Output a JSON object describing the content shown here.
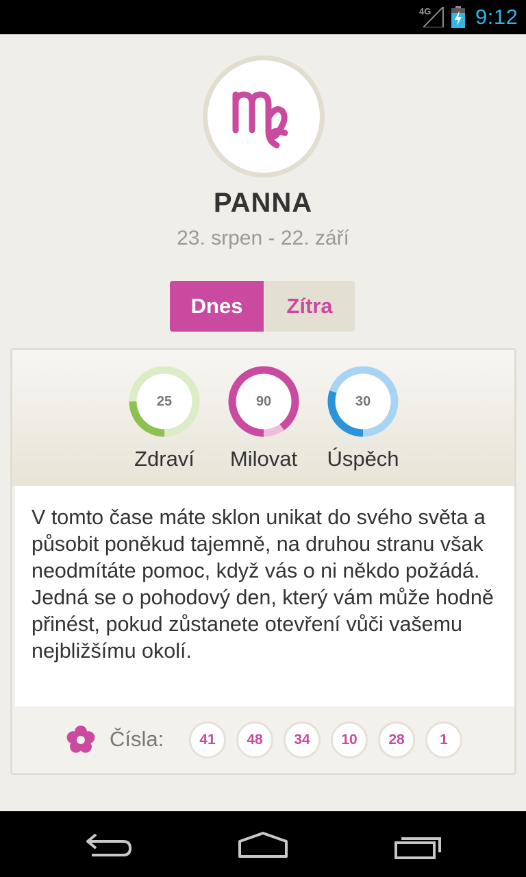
{
  "status_bar": {
    "network": "4G",
    "time": "9:12"
  },
  "sign": {
    "icon": "virgo-icon",
    "name": "PANNA",
    "dates": "23. srpen - 22. září"
  },
  "tabs": [
    {
      "label": "Dnes",
      "selected": true
    },
    {
      "label": "Zítra",
      "selected": false
    }
  ],
  "ratings": [
    {
      "label": "Zdraví",
      "value": "25",
      "fraction": 0.25,
      "color": "#8cc152",
      "track": "#dbecc6"
    },
    {
      "label": "Milovat",
      "value": "90",
      "fraction": 0.9,
      "color": "#c94a9f",
      "track": "#f0bcd9"
    },
    {
      "label": "Úspěch",
      "value": "30",
      "fraction": 0.3,
      "color": "#2b93d9",
      "track": "#a8d4f3"
    }
  ],
  "horoscope_text": "V tomto čase máte sklon unikat do svého světa a působit poněkud tajemně, na druhou stranu však neodmítáte pomoc, když vás o ni někdo požádá. Jedná se o pohodový den, který vám může hodně přinést, pokud zůstanete otevření vůči vašemu nejbližšímu okolí.",
  "lucky_numbers": {
    "icon": "flower-icon",
    "label": "Čísla:",
    "values": [
      "41",
      "48",
      "34",
      "10",
      "28",
      "1"
    ]
  },
  "colors": {
    "accent": "#c94a9f",
    "background": "#f0eee8",
    "status_blue": "#33b5e5"
  },
  "nav_bar": {
    "icons": [
      "back-icon",
      "home-icon",
      "recent-apps-icon"
    ]
  }
}
